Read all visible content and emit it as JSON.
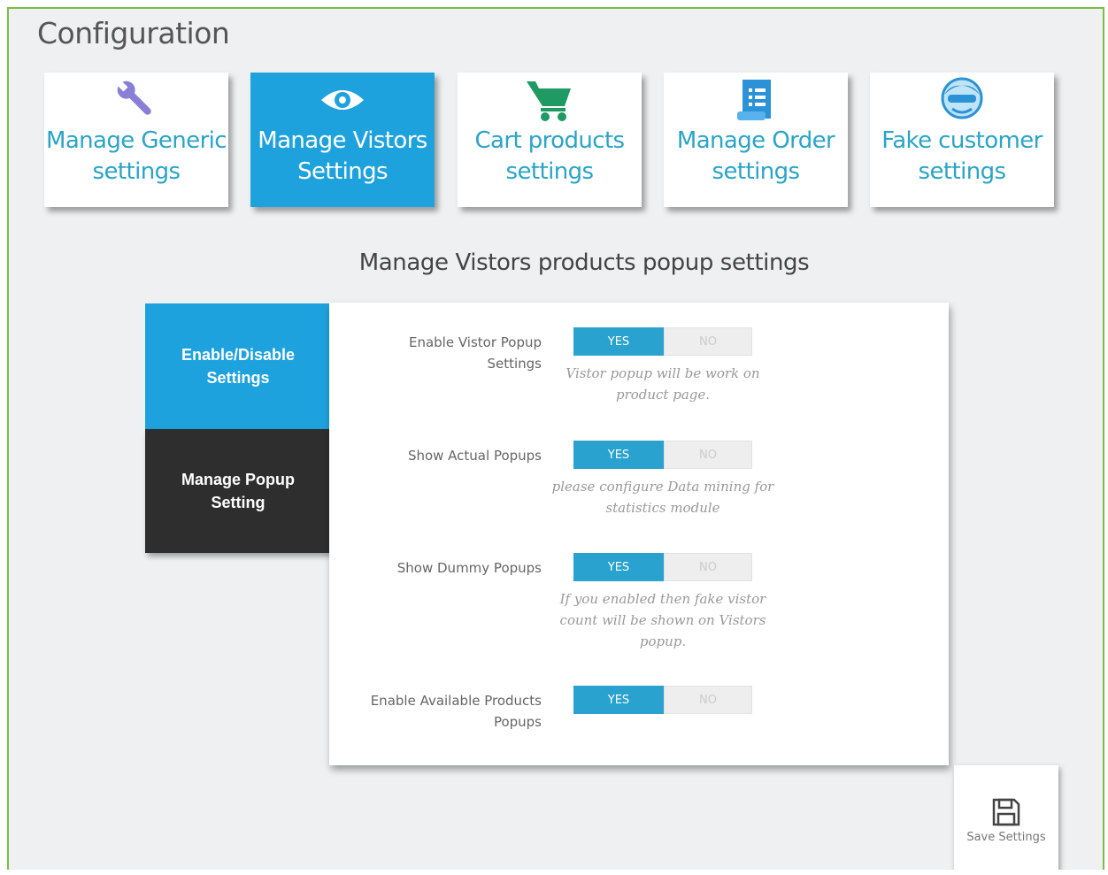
{
  "page": {
    "title": "Configuration"
  },
  "tiles": [
    {
      "label": "Manage Generic\nsettings",
      "icon": "wrench-icon",
      "active": false
    },
    {
      "label": "Manage Vistors\nSettings",
      "icon": "eye-icon",
      "active": true
    },
    {
      "label": "Cart products\nsettings",
      "icon": "cart-icon",
      "active": false
    },
    {
      "label": "Manage Order\nsettings",
      "icon": "document-icon",
      "active": false
    },
    {
      "label": "Fake customer\nsettings",
      "icon": "masked-user-icon",
      "active": false
    }
  ],
  "section": {
    "title": "Manage Vistors products popup settings"
  },
  "side_tabs": [
    {
      "label": "Enable/Disable\nSettings",
      "active": true
    },
    {
      "label": "Manage Popup\nSetting",
      "active": false
    }
  ],
  "settings": [
    {
      "label": "Enable Vistor Popup\nSettings",
      "yes": "YES",
      "no": "NO",
      "value": "YES",
      "help": "Vistor popup will be work on\nproduct page."
    },
    {
      "label": "Show Actual Popups",
      "yes": "YES",
      "no": "NO",
      "value": "YES",
      "help": "please configure Data mining for\nstatistics module"
    },
    {
      "label": "Show Dummy Popups",
      "yes": "YES",
      "no": "NO",
      "value": "YES",
      "help": "If you enabled then fake vistor\ncount will be shown on Vistors\npopup."
    },
    {
      "label": "Enable Available Products\nPopups",
      "yes": "YES",
      "no": "NO",
      "value": "YES",
      "help": ""
    }
  ],
  "save": {
    "label": "Save Settings",
    "icon": "floppy-disk-icon"
  },
  "colors": {
    "accent": "#1ea2de",
    "tile_text": "#2aa4c7",
    "dark_tab": "#2e2e2e",
    "border_green": "#7cbd45"
  }
}
